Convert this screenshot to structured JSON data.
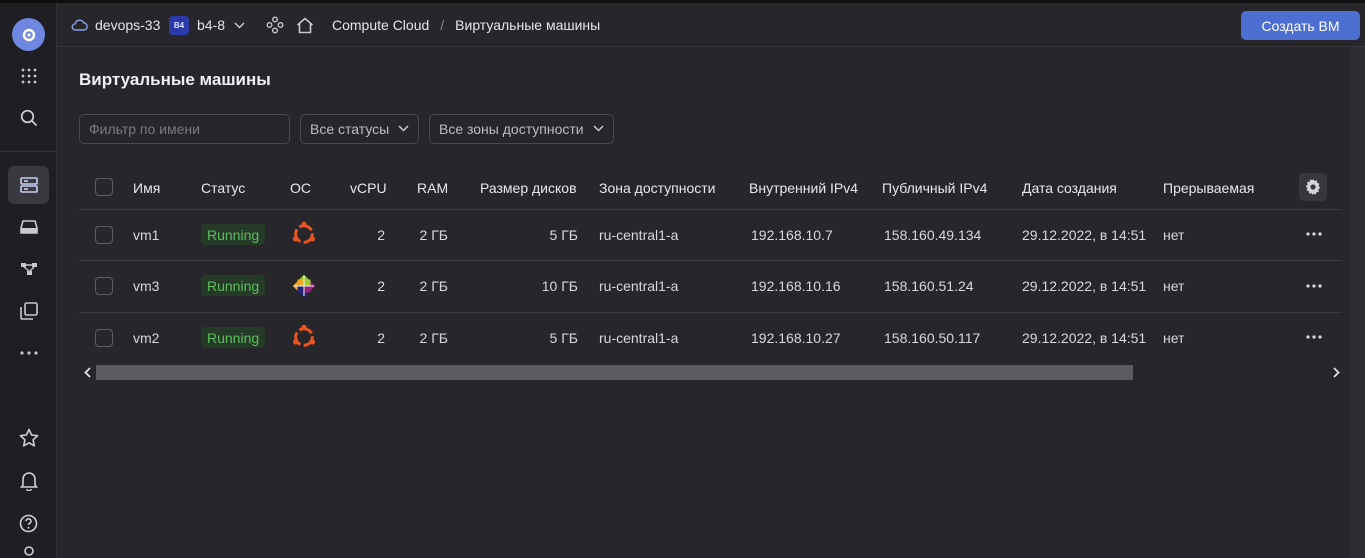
{
  "header": {
    "cloud_name": "devops-33",
    "folder_badge": "B4",
    "folder_name": "b4-8",
    "breadcrumb_service": "Compute Cloud",
    "breadcrumb_sep": "/",
    "breadcrumb_page": "Виртуальные машины",
    "create_button": "Создать ВМ"
  },
  "page": {
    "title": "Виртуальные машины",
    "filter_placeholder": "Фильтр по имени",
    "status_select": "Все статусы",
    "zone_select": "Все зоны доступности"
  },
  "table": {
    "columns": [
      "Имя",
      "Статус",
      "ОС",
      "vCPU",
      "RAM",
      "Размер дисков",
      "Зона доступности",
      "Внутренний IPv4",
      "Публичный IPv4",
      "Дата создания",
      "Прерываемая"
    ],
    "rows": [
      {
        "name": "vm1",
        "status": "Running",
        "os": "ubuntu-icon",
        "vcpu": "2",
        "ram": "2 ГБ",
        "disk": "5 ГБ",
        "zone": "ru-central1-a",
        "internal_ip": "192.168.10.7",
        "public_ip": "158.160.49.134",
        "created": "29.12.2022, в 14:51",
        "preemptible": "нет"
      },
      {
        "name": "vm3",
        "status": "Running",
        "os": "centos-icon",
        "vcpu": "2",
        "ram": "2 ГБ",
        "disk": "10 ГБ",
        "zone": "ru-central1-a",
        "internal_ip": "192.168.10.16",
        "public_ip": "158.160.51.24",
        "created": "29.12.2022, в 14:51",
        "preemptible": "нет"
      },
      {
        "name": "vm2",
        "status": "Running",
        "os": "ubuntu-icon",
        "vcpu": "2",
        "ram": "2 ГБ",
        "disk": "5 ГБ",
        "zone": "ru-central1-a",
        "internal_ip": "192.168.10.27",
        "public_ip": "158.160.50.117",
        "created": "29.12.2022, в 14:51",
        "preemptible": "нет"
      }
    ]
  },
  "colors": {
    "background": "#27262b",
    "rail": "#1f1e22",
    "accent": "#4d6fd1",
    "running_text": "#5cbe5e",
    "running_bg": "#263a28",
    "ubuntu": "#e95420"
  }
}
